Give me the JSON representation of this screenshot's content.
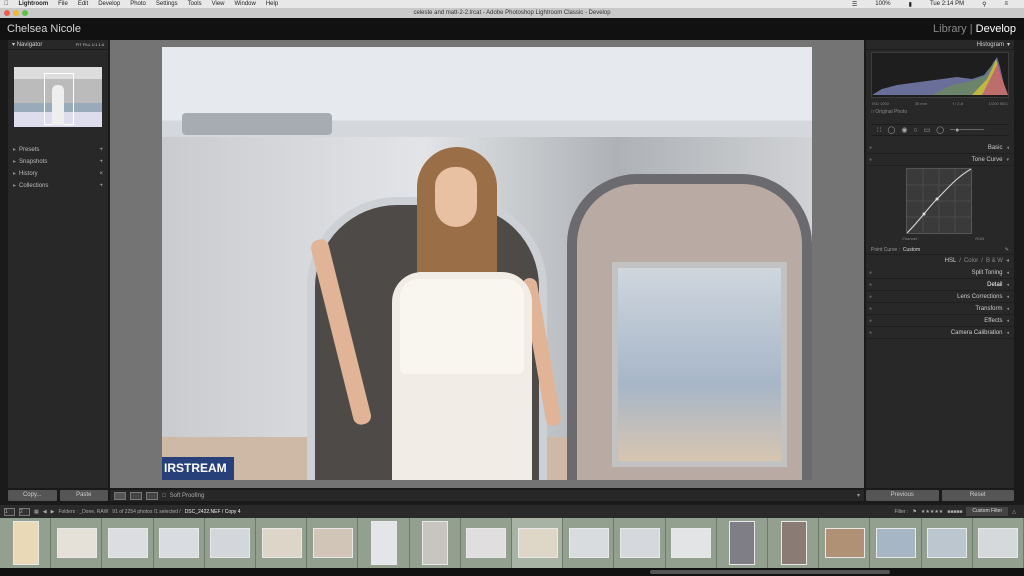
{
  "menubar": {
    "apple": "",
    "app": "Lightroom",
    "items": [
      "File",
      "Edit",
      "Develop",
      "Photo",
      "Settings",
      "Tools",
      "View",
      "Window",
      "Help"
    ],
    "battery": "100%",
    "clock": "Tue 2:14 PM"
  },
  "window": {
    "title": "celeste and matt-2-2.lrcat - Adobe Photoshop Lightroom Classic - Develop"
  },
  "identity": {
    "name": "Chelsea Nicole",
    "module_library": "Library",
    "separator": "|",
    "module_develop": "Develop"
  },
  "left_panel": {
    "navigator": "Navigator",
    "zoom_options": [
      "FIT",
      "FILL",
      "1:1",
      "1:4"
    ],
    "sections": [
      {
        "label": "Presets",
        "action": "+"
      },
      {
        "label": "Snapshots",
        "action": "+"
      },
      {
        "label": "History",
        "action": "×"
      },
      {
        "label": "Collections",
        "action": "+"
      }
    ],
    "copy_button": "Copy...",
    "paste_button": "Paste"
  },
  "photo": {
    "sign_text": "IRSTREAM"
  },
  "toolbar": {
    "soft_proofing": "Soft Proofing"
  },
  "right_panel": {
    "histogram": "Histogram",
    "histo_info": [
      "ISO 1000",
      "35 mm",
      "f / 2.8",
      "1/200 SEC"
    ],
    "original_photo": "Original Photo",
    "sections": {
      "basic": "Basic",
      "tone_curve": "Tone Curve",
      "channel_label": "Channel :",
      "channel_value": "RGB",
      "point_curve_label": "Point Curve :",
      "point_curve_value": "Custom",
      "hsl": "HSL",
      "color": "Color",
      "bw": "B & W",
      "split_toning": "Split Toning",
      "detail": "Detail",
      "lens_corrections": "Lens Corrections",
      "transform": "Transform",
      "effects": "Effects",
      "camera_calibration": "Camera Calibration"
    },
    "previous_button": "Previous",
    "reset_button": "Reset"
  },
  "filmstrip_bar": {
    "page1": "1",
    "page2": "2",
    "source": "Folders : _Done, RAW",
    "count": "91 of 2254 photos /1 selected /",
    "filename": "DSC_2422.NEF / Copy 4",
    "filter_label": "Filter :",
    "custom_filter": "Custom Filter"
  },
  "filmstrip": {
    "count": 20,
    "selected_index": 10
  }
}
